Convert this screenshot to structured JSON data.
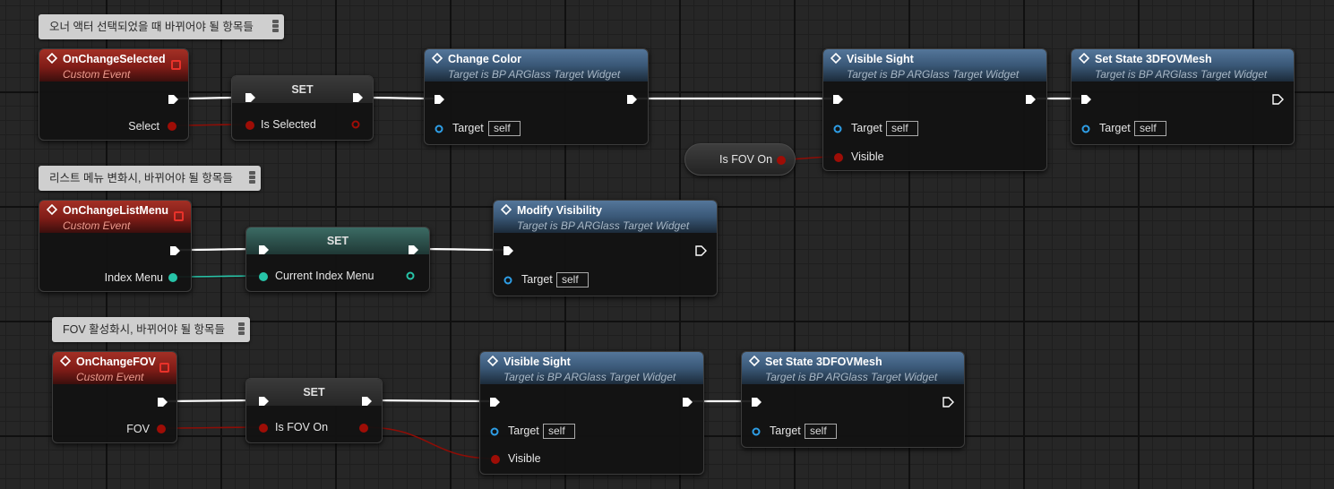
{
  "comments": [
    {
      "text": "오너 액터 선택되었을 때 바뀌어야 될 항목들"
    },
    {
      "text": "리스트 메뉴 변화시, 바뀌어야 될 항목들"
    },
    {
      "text": "FOV 활성화시, 바뀌어야 될 항목들"
    }
  ],
  "events": [
    {
      "title": "OnChangeSelected",
      "subtitle": "Custom Event",
      "output": "Select"
    },
    {
      "title": "OnChangeListMenu",
      "subtitle": "Custom Event",
      "output": "Index Menu"
    },
    {
      "title": "OnChangeFOV",
      "subtitle": "Custom Event",
      "output": "FOV"
    }
  ],
  "setters": [
    {
      "title": "SET",
      "variable": "Is Selected"
    },
    {
      "title": "SET",
      "variable": "Current Index Menu"
    },
    {
      "title": "SET",
      "variable": "Is FOV On"
    }
  ],
  "functions": [
    {
      "title": "Change Color",
      "subtitle": "Target is BP ARGlass Target Widget",
      "target_label": "Target",
      "target_value": "self"
    },
    {
      "title": "Visible Sight",
      "subtitle": "Target is BP ARGlass Target Widget",
      "target_label": "Target",
      "target_value": "self",
      "extra_label": "Visible"
    },
    {
      "title": "Set State 3DFOVMesh",
      "subtitle": "Target is BP ARGlass Target Widget",
      "target_label": "Target",
      "target_value": "self"
    },
    {
      "title": "Modify Visibility",
      "subtitle": "Target is BP ARGlass Target Widget",
      "target_label": "Target",
      "target_value": "self"
    },
    {
      "title": "Visible Sight",
      "subtitle": "Target is BP ARGlass Target Widget",
      "target_label": "Target",
      "target_value": "self",
      "extra_label": "Visible"
    },
    {
      "title": "Set State 3DFOVMesh",
      "subtitle": "Target is BP ARGlass Target Widget",
      "target_label": "Target",
      "target_value": "self"
    }
  ],
  "getters": [
    {
      "label": "Is FOV On"
    }
  ],
  "colors": {
    "exec_wire": "#ffffff",
    "bool_pin": "#9e0d06",
    "int_pin": "#27c4a8",
    "event_header": "#a33025",
    "function_header": "#3a5877"
  },
  "icons": {
    "event": "event-icon",
    "function": "function-icon",
    "exec": "exec-pin-icon",
    "comment_grip": "comment-grip-icon"
  }
}
